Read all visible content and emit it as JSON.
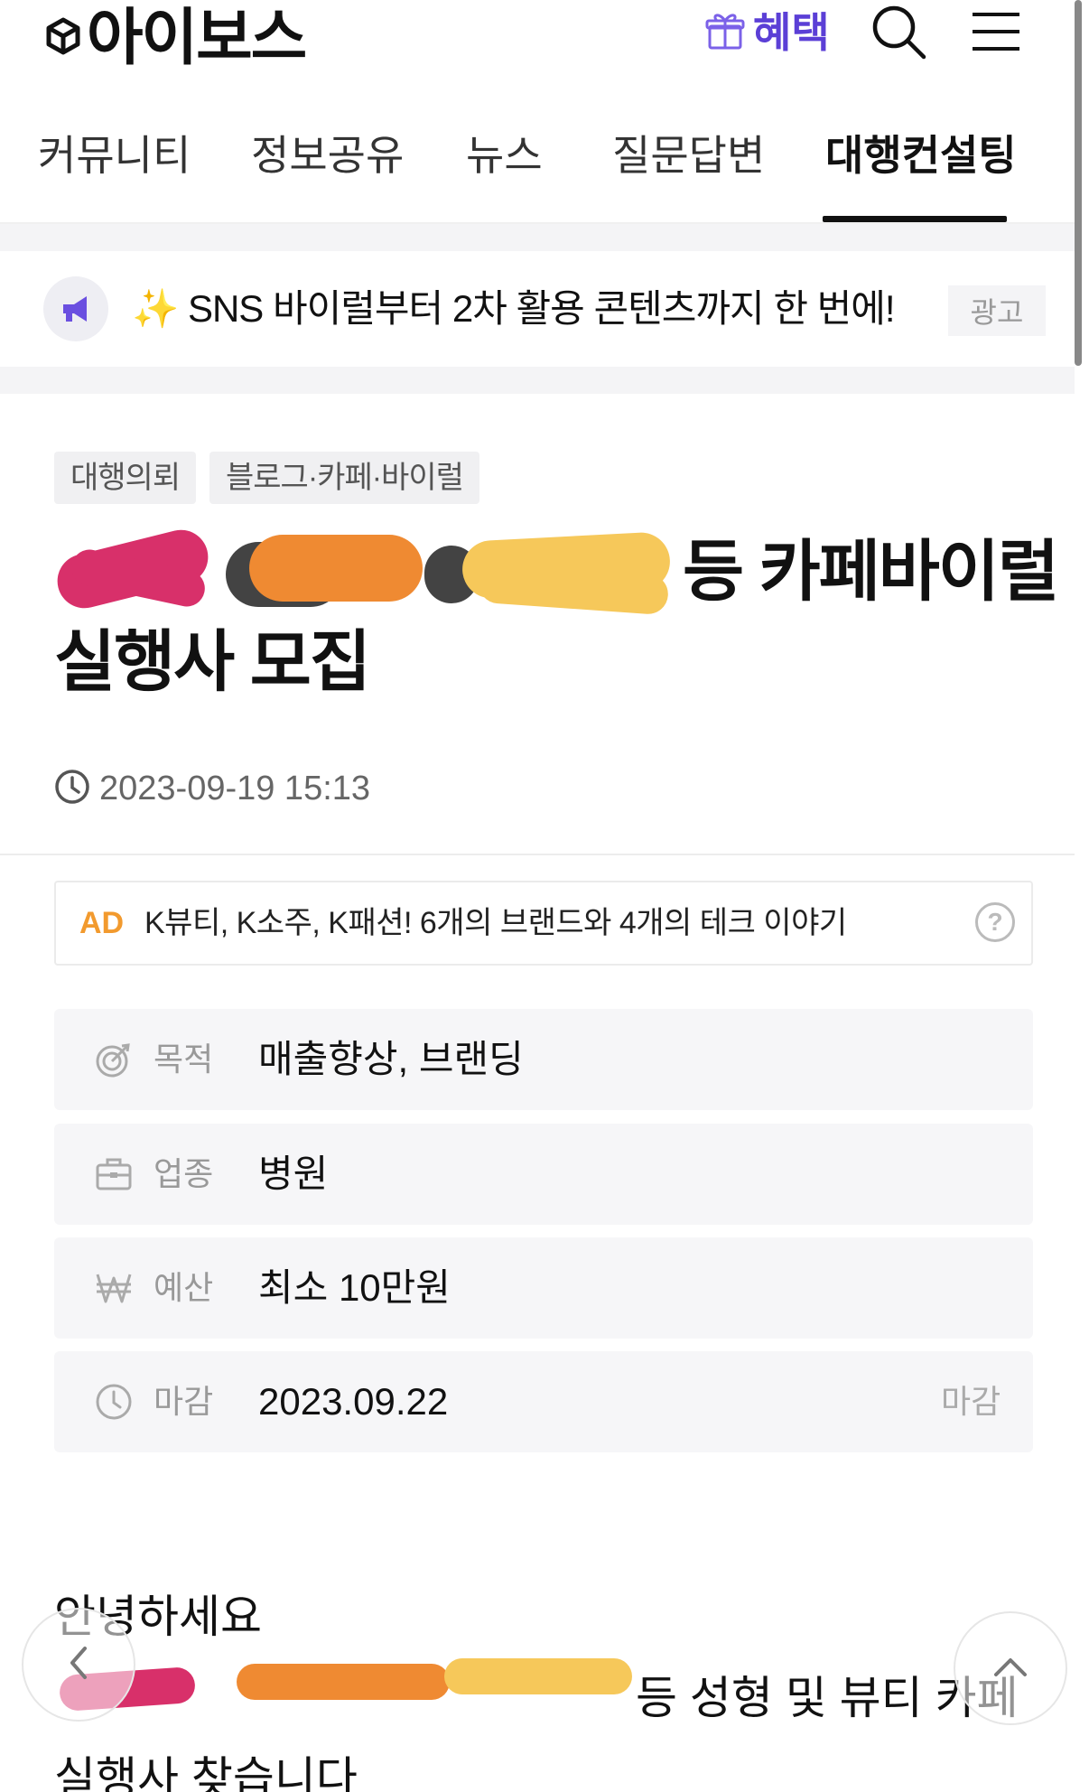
{
  "header": {
    "logo_text": "아이보스",
    "benefit_label": "혜택",
    "icons": [
      "logo-icon",
      "gift-icon",
      "search-icon",
      "menu-icon"
    ]
  },
  "nav": {
    "tabs": [
      {
        "label": "커뮤니티"
      },
      {
        "label": "정보공유"
      },
      {
        "label": "뉴스"
      },
      {
        "label": "질문답변"
      },
      {
        "label": "대행컨설팅",
        "active": true
      }
    ]
  },
  "banner": {
    "text": "✨ SNS 바이럴부터 2차 활용 콘텐츠까지 한 번에!",
    "ad_badge": "광고",
    "icon": "megaphone-icon"
  },
  "post": {
    "chips": [
      "대행의뢰",
      "블로그·카페·바이럴"
    ],
    "title_line1_visible": "등 카페바이럴",
    "title_line2": "실행사 모집",
    "datetime": "2023-09-19 15:13"
  },
  "ad": {
    "tag": "AD",
    "text": "K뷰티, K소주, K패션! 6개의 브랜드와 4개의 테크 이야기",
    "help": "?"
  },
  "details": [
    {
      "icon": "target-icon",
      "label": "목적",
      "value": "매출향상, 브랜딩"
    },
    {
      "icon": "briefcase-icon",
      "label": "업종",
      "value": "병원"
    },
    {
      "icon": "won-icon",
      "label": "예산",
      "value": "최소 10만원"
    },
    {
      "icon": "clock-icon",
      "label": "마감",
      "value": "2023.09.22",
      "status": "마감"
    }
  ],
  "content": {
    "line1": "안녕하세요",
    "line2_visible": "등 성형 및 뷰티 카페",
    "line3": "실행사 찾습니다"
  },
  "colors": {
    "accent_purple": "#5b3fd6",
    "ad_orange": "#f29a2e",
    "scribble_pink": "#d8306a",
    "scribble_orange": "#ef8a32",
    "scribble_yellow": "#f6c85a"
  }
}
